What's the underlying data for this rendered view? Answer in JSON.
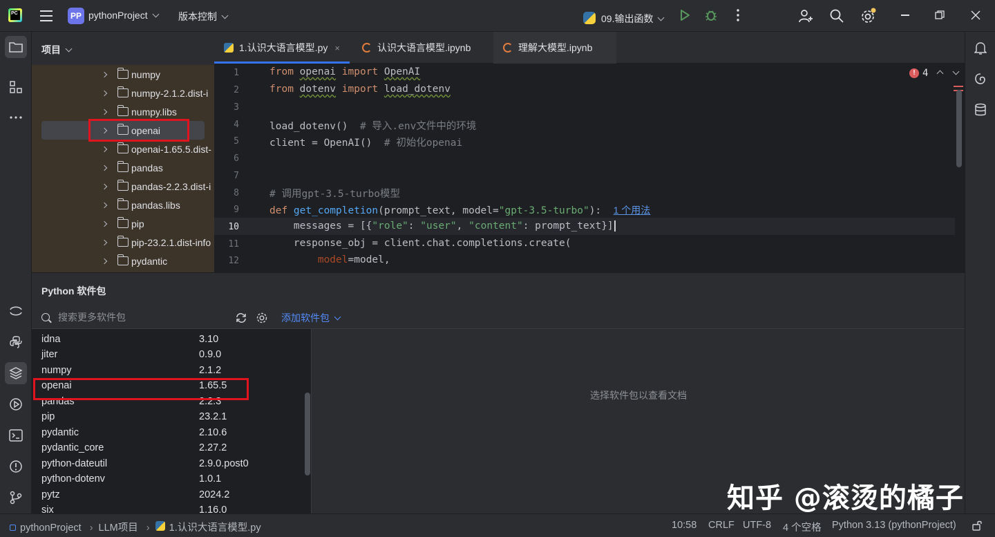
{
  "titlebar": {
    "project_badge": "PP",
    "project_name": "pythonProject",
    "vcs_menu": "版本控制",
    "run_config": "09.输出函数"
  },
  "project_panel": {
    "header": "项目",
    "tree": [
      "numpy",
      "numpy-2.1.2.dist-i",
      "numpy.libs",
      "openai",
      "openai-1.65.5.dist-",
      "pandas",
      "pandas-2.2.3.dist-i",
      "pandas.libs",
      "pip",
      "pip-23.2.1.dist-info",
      "pydantic"
    ],
    "selected": "openai"
  },
  "tabs": [
    {
      "label": "1.认识大语言模型.py",
      "close": "×"
    },
    {
      "label": "认识大语言模型.ipynb"
    },
    {
      "label": "理解大模型.ipynb"
    }
  ],
  "editor": {
    "error_count": "4",
    "line_numbers": [
      "1",
      "2",
      "3",
      "4",
      "5",
      "6",
      "7",
      "8",
      "9",
      "10",
      "11",
      "12"
    ],
    "usage_hint": "1 个用法"
  },
  "packages": {
    "title": "Python 软件包",
    "search_placeholder": "搜索更多软件包",
    "add_package": "添加软件包",
    "doc_hint": "选择软件包以查看文档",
    "rows": [
      {
        "name": "idna",
        "version": "3.10"
      },
      {
        "name": "jiter",
        "version": "0.9.0"
      },
      {
        "name": "numpy",
        "version": "2.1.2"
      },
      {
        "name": "openai",
        "version": "1.65.5"
      },
      {
        "name": "pandas",
        "version": "2.2.3"
      },
      {
        "name": "pip",
        "version": "23.2.1"
      },
      {
        "name": "pydantic",
        "version": "2.10.6"
      },
      {
        "name": "pydantic_core",
        "version": "2.27.2"
      },
      {
        "name": "python-dateutil",
        "version": "2.9.0.post0"
      },
      {
        "name": "python-dotenv",
        "version": "1.0.1"
      },
      {
        "name": "pytz",
        "version": "2024.2"
      },
      {
        "name": "six",
        "version": "1.16.0"
      }
    ]
  },
  "statusbar": {
    "crumb_project": "pythonProject",
    "crumb_folder": "LLM项目",
    "crumb_file": "1.认识大语言模型.py",
    "position": "10:58",
    "line_sep": "CRLF",
    "encoding": "UTF-8",
    "indent": "4 个空格",
    "interpreter": "Python 3.13 (pythonProject)"
  },
  "watermark": "知乎 @滚烫的橘子",
  "colors": {
    "accent": "#3574f0",
    "highlight_box": "#e0141e",
    "error": "#db5c5c"
  }
}
